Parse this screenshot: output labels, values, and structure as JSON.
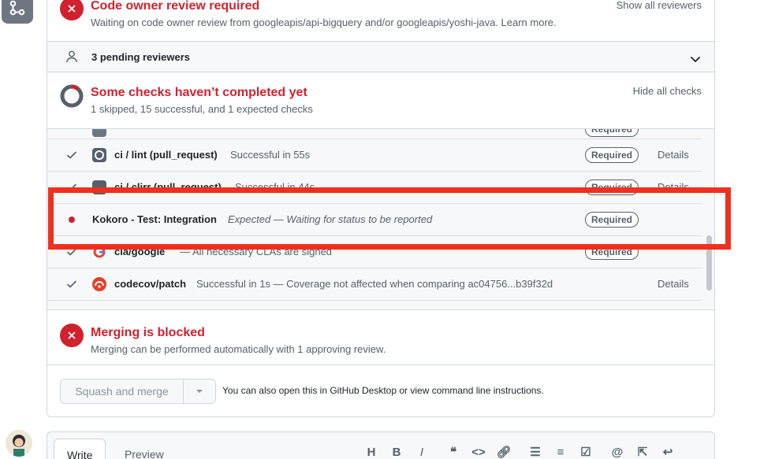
{
  "review": {
    "title": "Code owner review required",
    "subtitle": "Waiting on code owner review from googleapis/api-bigquery and/or googleapis/yoshi-java. Learn more.",
    "link": "Show all reviewers"
  },
  "pending": {
    "label": "3 pending reviewers"
  },
  "checks": {
    "title": "Some checks haven’t completed yet",
    "subtitle": "1 skipped, 15 successful, and 1 expected checks",
    "link": "Hide all checks",
    "rows": [
      {
        "name": "ci / lint (pull_request)",
        "desc": "Successful in 55s",
        "badge": "Required",
        "details": "Details",
        "status": "success"
      },
      {
        "name": "ci / clirr (pull_request)",
        "desc": "Successful in 44s",
        "badge": "Required",
        "details": "Details",
        "status": "success"
      },
      {
        "name": "Kokoro - Test: Integration",
        "desc": "Expected — Waiting for status to be reported",
        "badge": "Required",
        "status": "expected"
      },
      {
        "name": "cla/google",
        "desc": "All necessary CLAs are signed",
        "badge": "Required",
        "status": "success"
      },
      {
        "name": "codecov/patch",
        "desc": "Successful in 1s — Coverage not affected when comparing ac04756...b39f32d",
        "details": "Details",
        "status": "success"
      }
    ]
  },
  "merge": {
    "title": "Merging is blocked",
    "subtitle": "Merging can be performed automatically with 1 approving review."
  },
  "actions": {
    "merge_button": "Squash and merge",
    "note": "You can also open this in GitHub Desktop or view command line instructions."
  },
  "composer": {
    "tab_write": "Write",
    "tab_preview": "Preview",
    "tools": [
      "H",
      "B",
      "I"
    ]
  },
  "colors": {
    "danger": "#cf222e",
    "highlight": "#f0301e",
    "muted": "#57606a"
  }
}
